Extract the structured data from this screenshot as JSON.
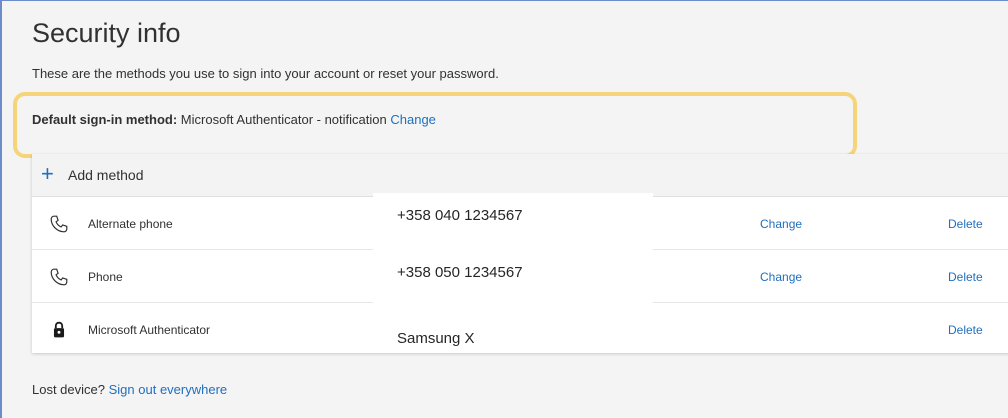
{
  "page": {
    "title": "Security info",
    "subtitle": "These are the methods you use to sign into your account or reset your password."
  },
  "default_method": {
    "label": "Default sign-in method:",
    "value": "Microsoft Authenticator - notification",
    "change_link": "Change"
  },
  "add_method": {
    "label": "Add method",
    "icon": "plus-icon"
  },
  "methods": [
    {
      "icon": "phone-icon",
      "name": "Alternate phone",
      "detail": "+358 040 1234567",
      "change": "Change",
      "delete": "Delete"
    },
    {
      "icon": "phone-icon",
      "name": "Phone",
      "detail": "+358 050 1234567",
      "change": "Change",
      "delete": "Delete"
    },
    {
      "icon": "lock-icon",
      "name": "Microsoft Authenticator",
      "detail": "Samsung X",
      "delete": "Delete"
    }
  ],
  "footer": {
    "prefix": "Lost device?",
    "link": "Sign out everywhere"
  },
  "colors": {
    "link": "#1f6fbf",
    "highlight": "#f6d57a",
    "frame_border": "#6b8cc7"
  }
}
